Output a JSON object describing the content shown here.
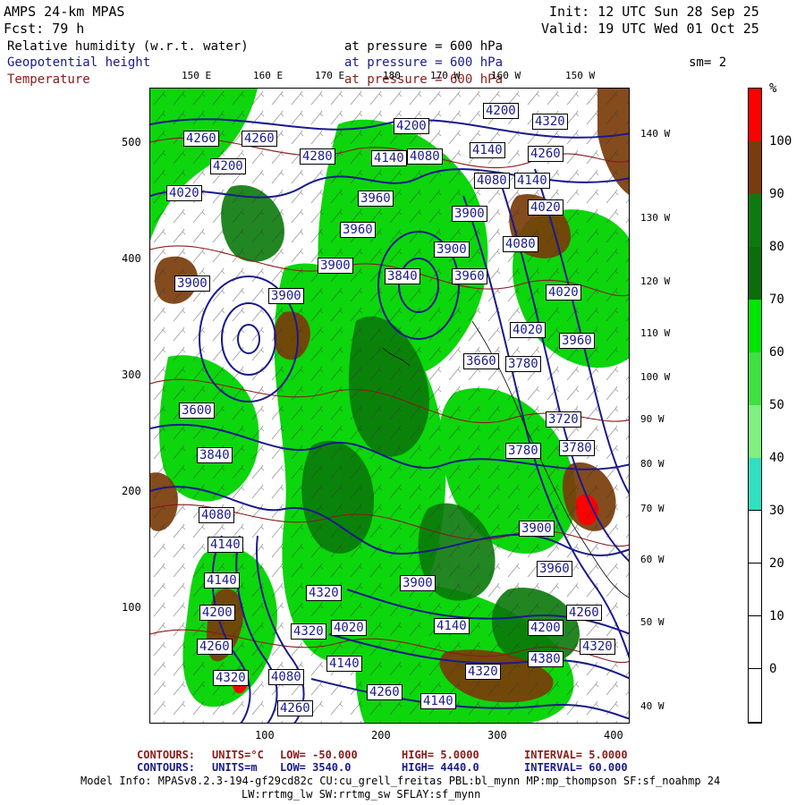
{
  "header": {
    "model": "AMPS 24-km MPAS",
    "forecast": "Fcst:    79 h",
    "init": "Init: 12 UTC Sun 28 Sep 25",
    "valid": "Valid: 19 UTC Wed 01 Oct 25",
    "sm": "sm= 2"
  },
  "variables": [
    {
      "name": "Relative humidity (w.r.t. water)",
      "level": "at pressure =  600 hPa",
      "color": "#000000"
    },
    {
      "name": "Geopotential height",
      "level": "at pressure =  600 hPa",
      "color": "#1a1a8c"
    },
    {
      "name": "Temperature",
      "level": "at pressure =  600 hPa",
      "color": "#8b1a1a"
    }
  ],
  "axes": {
    "y_ticks": [
      "500",
      "400",
      "300",
      "200",
      "100"
    ],
    "x_ticks": [
      "100",
      "200",
      "300",
      "400"
    ]
  },
  "longitude_labels": {
    "top": [
      "150 E",
      "160 E",
      "170 E",
      "180",
      "170 W",
      "160 W",
      "150 W"
    ],
    "right": [
      "140 W",
      "130 W",
      "120 W",
      "110 W",
      "100 W",
      "90 W",
      "80 W",
      "70 W",
      "60 W",
      "50 W",
      "40 W"
    ]
  },
  "colorbar": {
    "unit": "%",
    "labels": [
      "100",
      "90",
      "80",
      "70",
      "60",
      "50",
      "40",
      "30",
      "20",
      "10",
      "0"
    ],
    "segments": [
      {
        "color": "#ff0000"
      },
      {
        "color": "#7a3c0a"
      },
      {
        "color": "#0d7a0d"
      },
      {
        "color": "#0a6e0a"
      },
      {
        "color": "#00e600"
      },
      {
        "color": "#40e040"
      },
      {
        "color": "#80f080"
      },
      {
        "color": "#30e0c0"
      },
      {
        "color": "#ffffff"
      },
      {
        "color": "#ffffff"
      },
      {
        "color": "#ffffff"
      },
      {
        "color": "#ffffff"
      }
    ]
  },
  "height_labels": [
    "4260",
    "4260",
    "4280",
    "4200",
    "4200",
    "4320",
    "4260",
    "4140",
    "4140",
    "4080",
    "4080",
    "4140",
    "4200",
    "4020",
    "4020",
    "3960",
    "3960",
    "3900",
    "3900",
    "3900",
    "4080",
    "4020",
    "3900",
    "3900",
    "3840",
    "3960",
    "4020",
    "3960",
    "3780",
    "3660",
    "3720",
    "3780",
    "3780",
    "3600",
    "3840",
    "4080",
    "4140",
    "4140",
    "4200",
    "4260",
    "4320",
    "3900",
    "4020",
    "4140",
    "4080",
    "4140",
    "4200",
    "4260",
    "4320",
    "4380",
    "4320",
    "4260",
    "4140",
    "4260",
    "4320",
    "4320",
    "3900",
    "3960"
  ],
  "footer": {
    "temp_contours": {
      "label": "CONTOURS:",
      "units": "UNITS=°C",
      "low": "LOW= -50.000",
      "high": "HIGH=  5.0000",
      "interval": "INTERVAL=  5.0000",
      "color": "#8b1a1a"
    },
    "height_contours": {
      "label": "CONTOURS:",
      "units": "UNITS=m",
      "low": "LOW=  3540.0",
      "high": "HIGH=  4440.0",
      "interval": "INTERVAL=  60.000",
      "color": "#1a1a8c"
    },
    "model_info_1": "Model Info: MPASv8.2.3-194-gf29cd82c CU:cu_grell_freitas PBL:bl_mynn MP:mp_thompson SF:sf_noahmp 24",
    "model_info_2": "LW:rrtmg_lw SW:rrtmg_sw SFLAY:sf_mynn"
  }
}
